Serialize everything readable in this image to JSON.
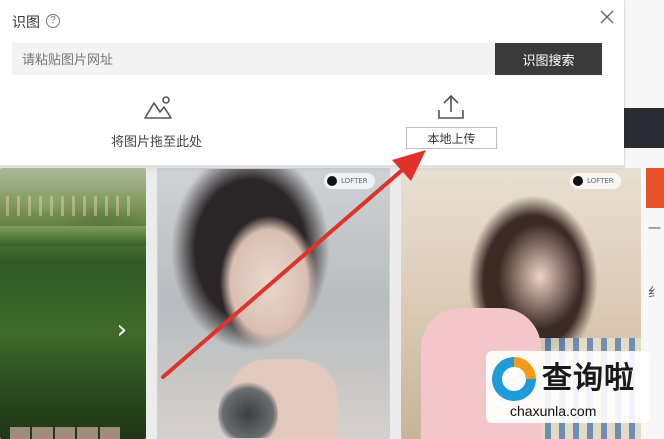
{
  "popup": {
    "title": "识图",
    "help": "?",
    "search_placeholder": "请粘贴图片网址",
    "search_button": "识图搜索",
    "drag_label": "将图片拖至此处",
    "upload_button": "本地上传"
  },
  "images": {
    "badge": "LOFTER"
  },
  "sidebar": {
    "chars": [
      "一",
      "纟"
    ]
  },
  "watermark": {
    "title": "查询啦",
    "url": "chaxunla.com"
  },
  "colors": {
    "annotation_arrow": "#e0322b",
    "search_button_bg": "#3a3a3a"
  }
}
